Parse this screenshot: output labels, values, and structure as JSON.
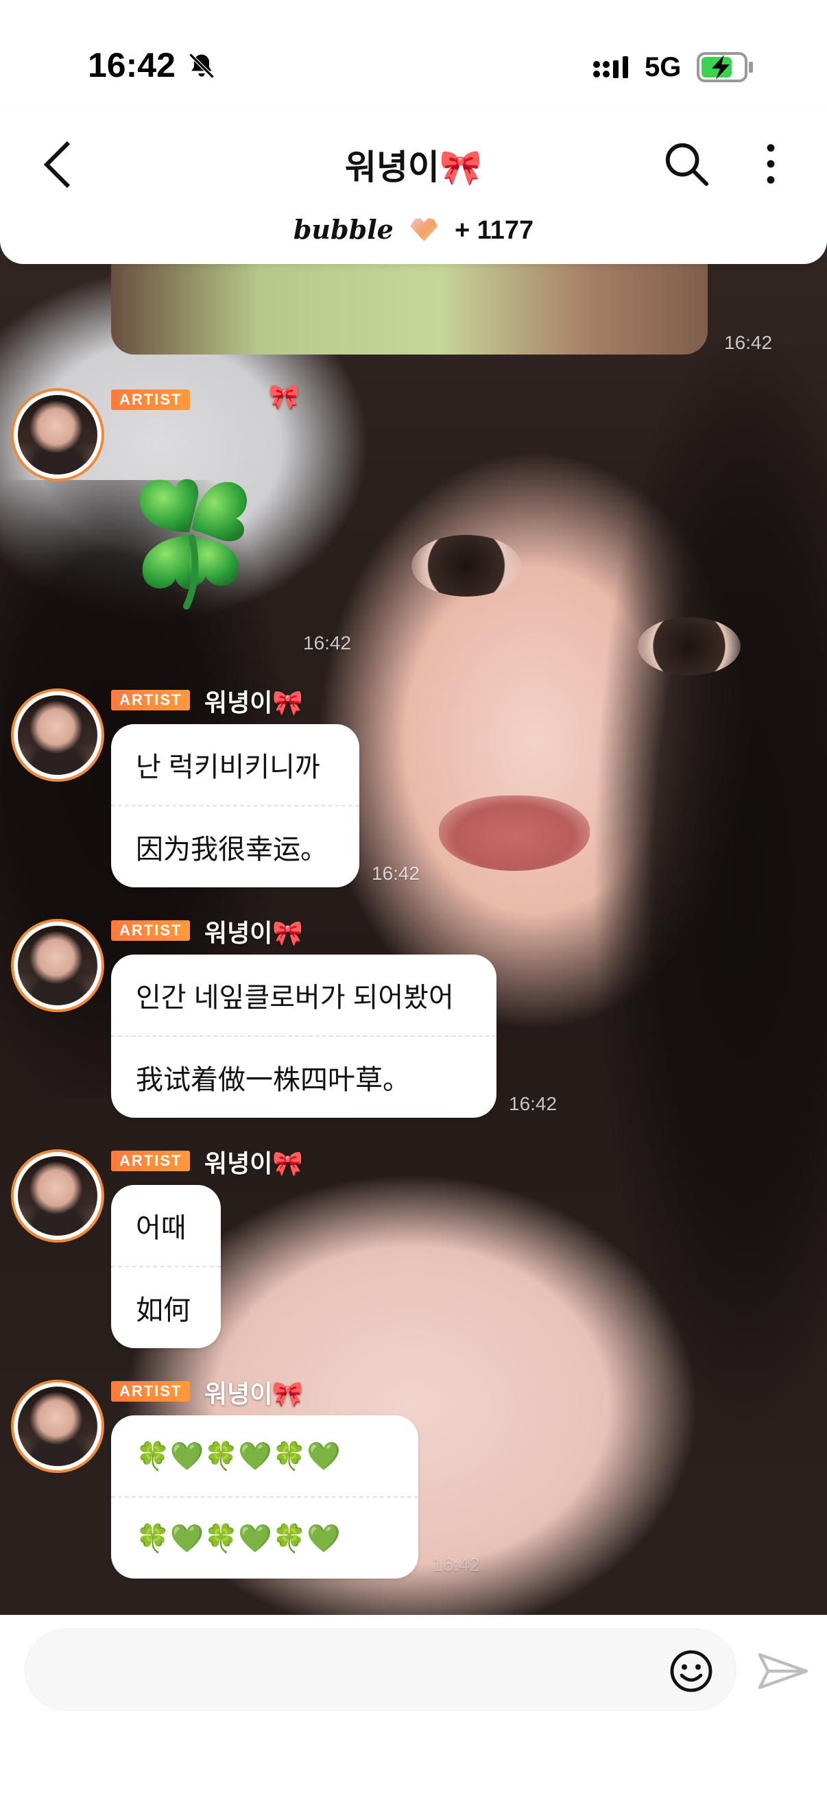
{
  "status_bar": {
    "time": "16:42",
    "network": "5G"
  },
  "header": {
    "title": "워녕이🎀",
    "bubble_label": "bubble",
    "bubble_count": "+ 1177"
  },
  "messages": [
    {
      "timestamp": "16:42"
    },
    {
      "badge": "ARTIST",
      "sender": "🎀",
      "timestamp": "16:42"
    },
    {
      "badge": "ARTIST",
      "sender": "워녕이🎀",
      "lines": [
        "난 럭키비키니까",
        "因为我很幸运。"
      ],
      "timestamp": "16:42"
    },
    {
      "badge": "ARTIST",
      "sender": "워녕이🎀",
      "lines": [
        "인간 네잎클로버가 되어봤어",
        "我试着做一株四叶草。"
      ],
      "timestamp": "16:42"
    },
    {
      "badge": "ARTIST",
      "sender": "워녕이🎀",
      "lines": [
        "어때",
        "如何"
      ]
    },
    {
      "badge": "ARTIST",
      "sender": "워녕이🎀",
      "lines": [
        "🍀💚🍀💚🍀💚",
        "🍀💚🍀💚🍀💚"
      ],
      "timestamp": "16:42"
    }
  ],
  "composer": {
    "placeholder": ""
  },
  "icons": {
    "back": "chevron-left",
    "search": "magnifier",
    "more": "vertical-dots",
    "emoji": "smiley",
    "send": "paper-plane",
    "mute": "bell-slash",
    "sticker": "four-leaf-clover"
  },
  "colors": {
    "accent": "#ff8a3c",
    "avatar_ring": "#f08a3a"
  }
}
